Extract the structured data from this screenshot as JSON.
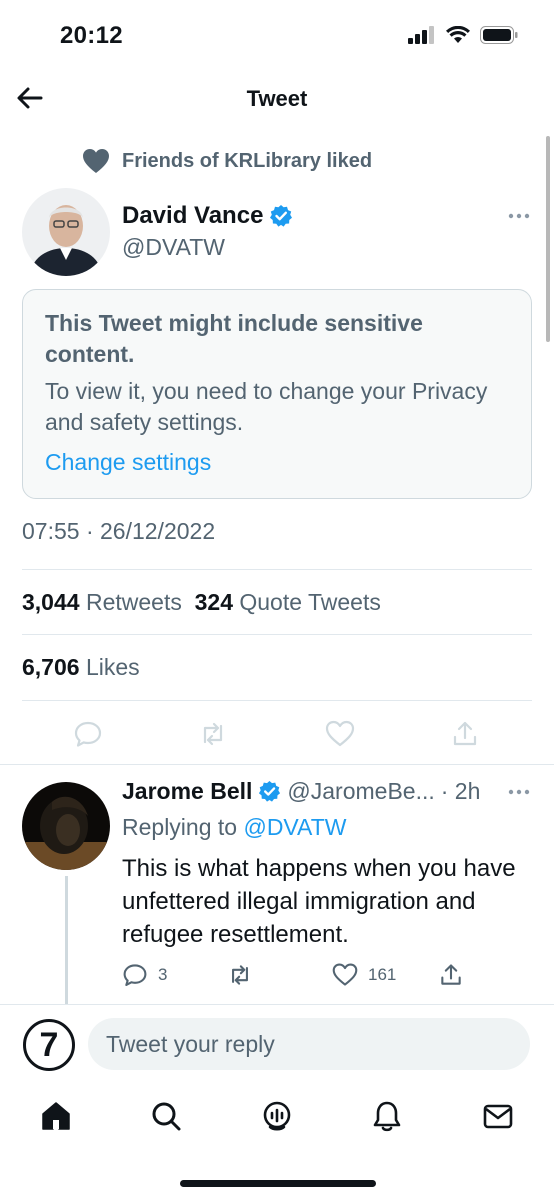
{
  "status_bar": {
    "time": "20:12"
  },
  "nav": {
    "title": "Tweet"
  },
  "social_context": {
    "text": "Friends of KRLibrary liked",
    "icon": "heart-icon"
  },
  "tweet": {
    "author_name": "David Vance",
    "author_handle": "@DVATW",
    "verified": true,
    "sensitive_title": "This Tweet might include sensitive content.",
    "sensitive_body": "To view it, you need to change your Privacy and safety settings.",
    "sensitive_link": "Change settings",
    "datetime": "07:55 · 26/12/2022",
    "retweets_count": "3,044",
    "retweets_label": "Retweets",
    "quotes_count": "324",
    "quotes_label": "Quote Tweets",
    "likes_count": "6,706",
    "likes_label": "Likes"
  },
  "reply": {
    "author_name": "Jarome Bell",
    "author_handle": "@JaromeBe...",
    "time": "· 2h",
    "replying_prefix": "Replying to",
    "replying_to": "@DVATW",
    "text": "This is what happens when you have unfettered illegal immigration and refugee resettlement.",
    "reply_count": "3",
    "like_count": "161"
  },
  "composer": {
    "placeholder": "Tweet your reply",
    "avatar_glyph": "7"
  },
  "tabs": [
    "home-icon",
    "search-icon",
    "spaces-icon",
    "notifications-icon",
    "messages-icon"
  ],
  "colors": {
    "accent": "#1d9bf0",
    "text": "#0f1419",
    "muted": "#536471",
    "border": "#cfd9de"
  }
}
